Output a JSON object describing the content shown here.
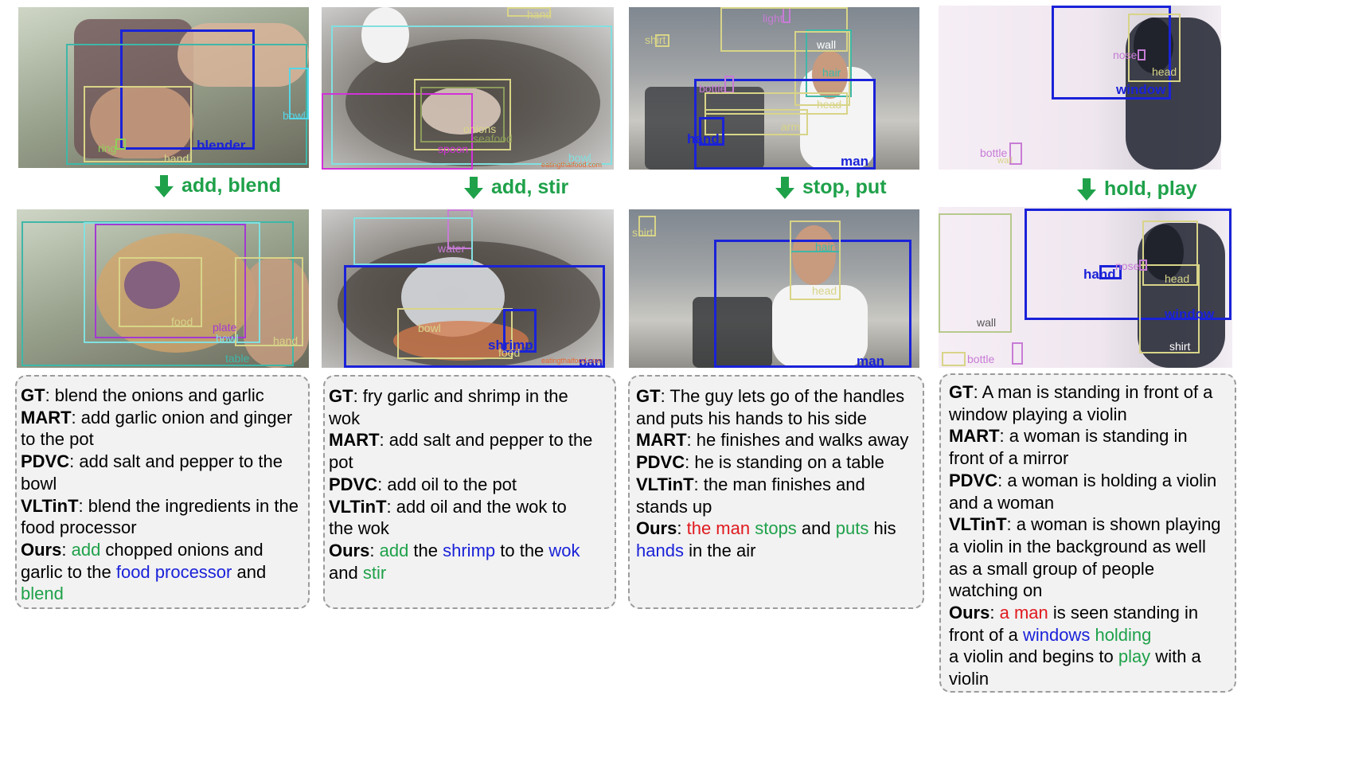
{
  "arrows": [
    {
      "label": "add, blend"
    },
    {
      "label": "add, stir"
    },
    {
      "label": "stop, put"
    },
    {
      "label": "hold, play"
    }
  ],
  "frames": {
    "c1_top": {
      "labels": {
        "blender": "blender",
        "bowl": "bowl",
        "ring": "ring",
        "hand": "hand"
      }
    },
    "c1_bot": {
      "labels": {
        "food": "food",
        "plate": "plate",
        "bowl": "bowl",
        "hand": "hand",
        "table": "table"
      }
    },
    "c2_top": {
      "labels": {
        "hand": "hand",
        "bowl": "bowl",
        "spoon": "spoon",
        "onions": "onions",
        "seafood": "seafood",
        "watermark": "eatingthaifood.com"
      }
    },
    "c2_bot": {
      "labels": {
        "water": "water",
        "bowl": "bowl",
        "shrimp": "shrimp",
        "food": "food",
        "pan": "pan",
        "watermark": "eatingthaifood.com"
      }
    },
    "c3_top": {
      "labels": {
        "light": "light",
        "shirt": "shirt",
        "wall": "wall",
        "hair": "hair",
        "bottle": "bottle",
        "head": "head",
        "arm": "arm",
        "hand": "hand",
        "man": "man"
      }
    },
    "c3_bot": {
      "labels": {
        "shirt": "shirt",
        "hair": "hair",
        "head": "head",
        "man": "man"
      }
    },
    "c4_top": {
      "labels": {
        "nose": "nose",
        "head": "head",
        "window": "window",
        "bottle": "bottle",
        "wall": "wall"
      }
    },
    "c4_bot": {
      "labels": {
        "hand": "hand",
        "nose": "nose",
        "head": "head",
        "wall": "wall",
        "window": "window",
        "shirt": "shirt",
        "bottle": "bottle"
      }
    }
  },
  "captions": [
    {
      "gt": {
        "key": "GT",
        "text": ": blend the onions and garlic"
      },
      "mart": {
        "key": "MART",
        "l1": ": add garlic onion and ginger",
        "l2": "to the pot"
      },
      "pdvc": {
        "key": "PDVC",
        "l1": ": add salt and pepper to the",
        "l2": "bowl"
      },
      "vlt": {
        "key": "VLTinT",
        "l1": ": blend the ingredients in the",
        "l2": "food processor"
      },
      "ours": {
        "key": "Ours",
        "sep": ": ",
        "w1": "add",
        "w2": " chopped onions and",
        "w3": "garlic to the ",
        "w4": "food processor",
        "w5": " and",
        "w6": "blend"
      }
    },
    {
      "gt": {
        "key": "GT",
        "l1": ": fry garlic and shrimp in the",
        "l2": "wok"
      },
      "mart": {
        "key": "MART",
        "l1": ": add salt and pepper to the",
        "l2": "pot"
      },
      "pdvc": {
        "key": "PDVC",
        "text": ": add oil to the pot"
      },
      "vlt": {
        "key": "VLTinT",
        "l1": ": add oil and the wok to",
        "l2": "the wok"
      },
      "ours": {
        "key": "Ours",
        "sep": ": ",
        "w1": "add",
        "w2": " the ",
        "w3": "shrimp",
        "w4": " to the ",
        "w5": "wok",
        "w6": "and ",
        "w7": "stir"
      }
    },
    {
      "gt": {
        "key": "GT",
        "l1": ": The guy lets go of the handles",
        "l2": "and puts his hands to his side"
      },
      "mart": {
        "key": "MART",
        "text": ": he finishes and walks away"
      },
      "pdvc": {
        "key": "PDVC",
        "text": ": he is standing on a table"
      },
      "vlt": {
        "key": "VLTinT",
        "l1": ": the man finishes and",
        "l2": "stands up"
      },
      "ours": {
        "key": "Ours",
        "sep": ": ",
        "w1": "the man",
        "w2": " ",
        "w3": "stops",
        "w4": " and ",
        "w5": "puts",
        "w6": " his",
        "w7": "hands",
        "w8": " in the air"
      }
    },
    {
      "gt": {
        "key": "GT",
        "l1": ": A man is standing in front of a",
        "l2": "window playing a violin"
      },
      "mart": {
        "key": "MART",
        "l1": ": a woman is standing in",
        "l2": "front of a mirror"
      },
      "pdvc": {
        "key": "PDVC",
        "l1": ": a woman is holding a violin",
        "l2": "and a woman"
      },
      "vlt": {
        "key": "VLTinT",
        "l1": ": a woman is shown playing",
        "l2": "a violin in the background as well",
        "l3": "as a small group of people",
        "l4": "watching on"
      },
      "ours": {
        "key": "Ours",
        "sep": ": ",
        "w1": "a man",
        "w2": " is seen standing in",
        "w3": "front of a ",
        "w4": "windows",
        "w5": " ",
        "w6": "holding",
        "w7": "a violin and begins to ",
        "w8": "play",
        "w9": " with a",
        "w10": "violin"
      }
    }
  ],
  "colors": {
    "green": "#1fa14a",
    "blue": "#1a22d8",
    "red": "#e0191e",
    "panel_bg": "#f2f2f2",
    "panel_border": "#9b9b9b"
  }
}
